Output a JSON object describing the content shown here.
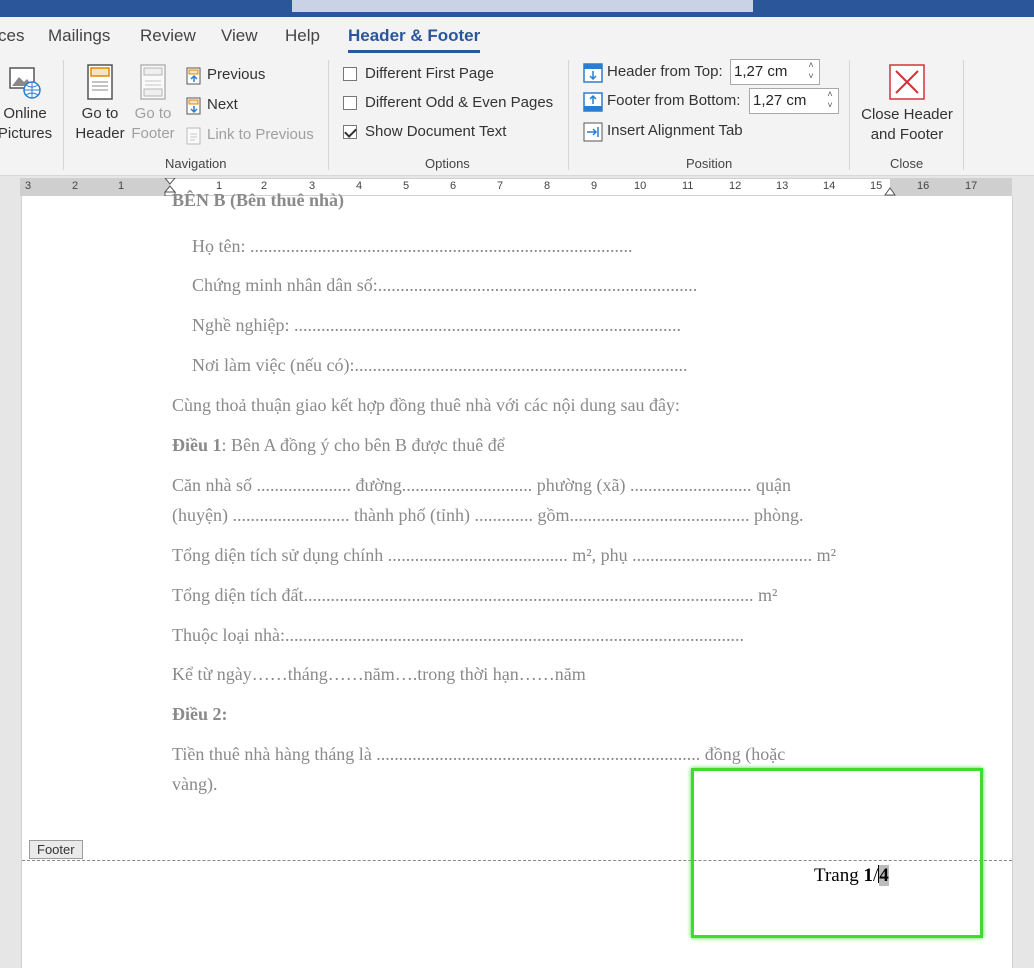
{
  "tabs": [
    {
      "label": "ces",
      "active": false
    },
    {
      "label": "Mailings",
      "active": false
    },
    {
      "label": "Review",
      "active": false
    },
    {
      "label": "View",
      "active": false
    },
    {
      "label": "Help",
      "active": false
    },
    {
      "label": "Header & Footer",
      "active": true
    }
  ],
  "ribbon": {
    "insert": {
      "online_pictures_line1": "Online",
      "online_pictures_line2": "Pictures"
    },
    "navigation": {
      "group_label": "Navigation",
      "go_to_header_line1": "Go to",
      "go_to_header_line2": "Header",
      "go_to_footer_line1": "Go to",
      "go_to_footer_line2": "Footer",
      "previous": "Previous",
      "next": "Next",
      "link_to_previous": "Link to Previous"
    },
    "options": {
      "group_label": "Options",
      "different_first_page": "Different First Page",
      "different_odd_even": "Different Odd & Even Pages",
      "show_document_text": "Show Document Text",
      "different_first_page_checked": false,
      "different_odd_even_checked": false,
      "show_document_text_checked": true
    },
    "position": {
      "group_label": "Position",
      "header_from_top_label": "Header from Top:",
      "header_from_top_value": "1,27 cm",
      "footer_from_bottom_label": "Footer from Bottom:",
      "footer_from_bottom_value": "1,27 cm",
      "insert_alignment_tab": "Insert Alignment Tab"
    },
    "close": {
      "group_label": "Close",
      "close_line1": "Close Header",
      "close_line2": "and Footer"
    }
  },
  "ruler": {
    "labels": [
      "3",
      "2",
      "1",
      "1",
      "2",
      "3",
      "4",
      "5",
      "6",
      "7",
      "8",
      "9",
      "10",
      "11",
      "12",
      "13",
      "14",
      "15",
      "16",
      "17"
    ]
  },
  "document": {
    "cut_heading": "BÊN B (Bên thuê nhà)",
    "lines": [
      "Họ tên: .....................................................................................",
      "Chứng minh nhân dân số:.......................................................................",
      "Nghề nghiệp: ......................................................................................",
      "Nơi làm việc (nếu có):..........................................................................",
      "Cùng thoả thuận giao kết hợp đồng thuê nhà với các nội dung sau đây:"
    ],
    "dieu1_label": "Điều 1",
    "dieu1_text": ": Bên A đồng ý cho bên B được thuê để",
    "can_nha_1": "Căn nhà số ..................... đường............................. phường (xã) ........................... quận",
    "can_nha_2": "(huyện) .......................... thành phố (tỉnh) ............. gồm........................................ phòng.",
    "tong_dien_tich_su_dung": "Tổng diện tích sử dụng chính ........................................ m², phụ ........................................ m²",
    "tong_dien_tich_dat": "Tổng diện tích đất.................................................................................................... m²",
    "thuoc_loai_nha": "Thuộc loại nhà:......................................................................................................",
    "ke_tu_ngay": "Kể từ ngày……tháng……năm….trong thời hạn……năm",
    "dieu2_label": "Điều 2:",
    "tien_thue_1": "Tiền thuê nhà hàng tháng là ........................................................................ đồng            (hoặc",
    "tien_thue_2": "vàng)."
  },
  "footer": {
    "tag": "Footer",
    "prefix": "Trang ",
    "page": "1",
    "slash": "/",
    "total": "4"
  }
}
